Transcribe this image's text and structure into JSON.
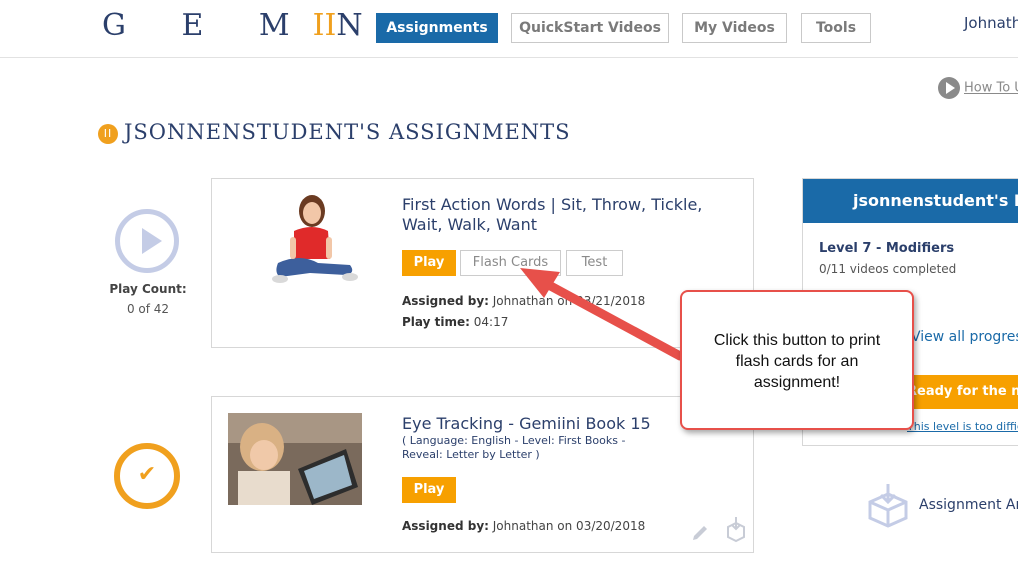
{
  "header": {
    "logo_text": "GEMIINI",
    "username": "Johnathan",
    "nav": [
      "Assignments",
      "QuickStart Videos",
      "My Videos",
      "Tools"
    ]
  },
  "help_link": "How To Use",
  "page_title": "JSONNENSTUDENT'S ASSIGNMENTS",
  "assignments": [
    {
      "title": "First Action Words | Sit, Throw, Tickle, Wait, Walk, Want",
      "buttons": [
        "Play",
        "Flash Cards",
        "Test"
      ],
      "assigned_by_label": "Assigned by:",
      "assigned_by_value": "Johnathan on 03/21/2018",
      "play_time_label": "Play time:",
      "play_time_value": "04:17",
      "play_count_label": "Play Count:",
      "play_count_value": "0 of 42"
    },
    {
      "title": "Eye Tracking - Gemiini Book 15",
      "subtitle": "( Language: English - Level: First Books - Reveal: Letter by Letter )",
      "buttons": [
        "Play"
      ],
      "assigned_by_label": "Assigned by:",
      "assigned_by_value": "Johnathan on 03/20/2018"
    }
  ],
  "progress_panel": {
    "header": "jsonnenstudent's Progress",
    "level": "Level 7 - Modifiers",
    "completed": "0/11 videos completed",
    "view_all": "View all progress",
    "next_step": "Ready for the next step? Let's",
    "too_difficult": "This level is too difficult"
  },
  "assignment_archive": "Assignment Archive",
  "callout": {
    "text": "Click this button to print flash cards for an assignment!"
  },
  "colors": {
    "brand_blue": "#1a6aa8",
    "accent_orange": "#f7a000",
    "callout_red": "#e7504a"
  }
}
